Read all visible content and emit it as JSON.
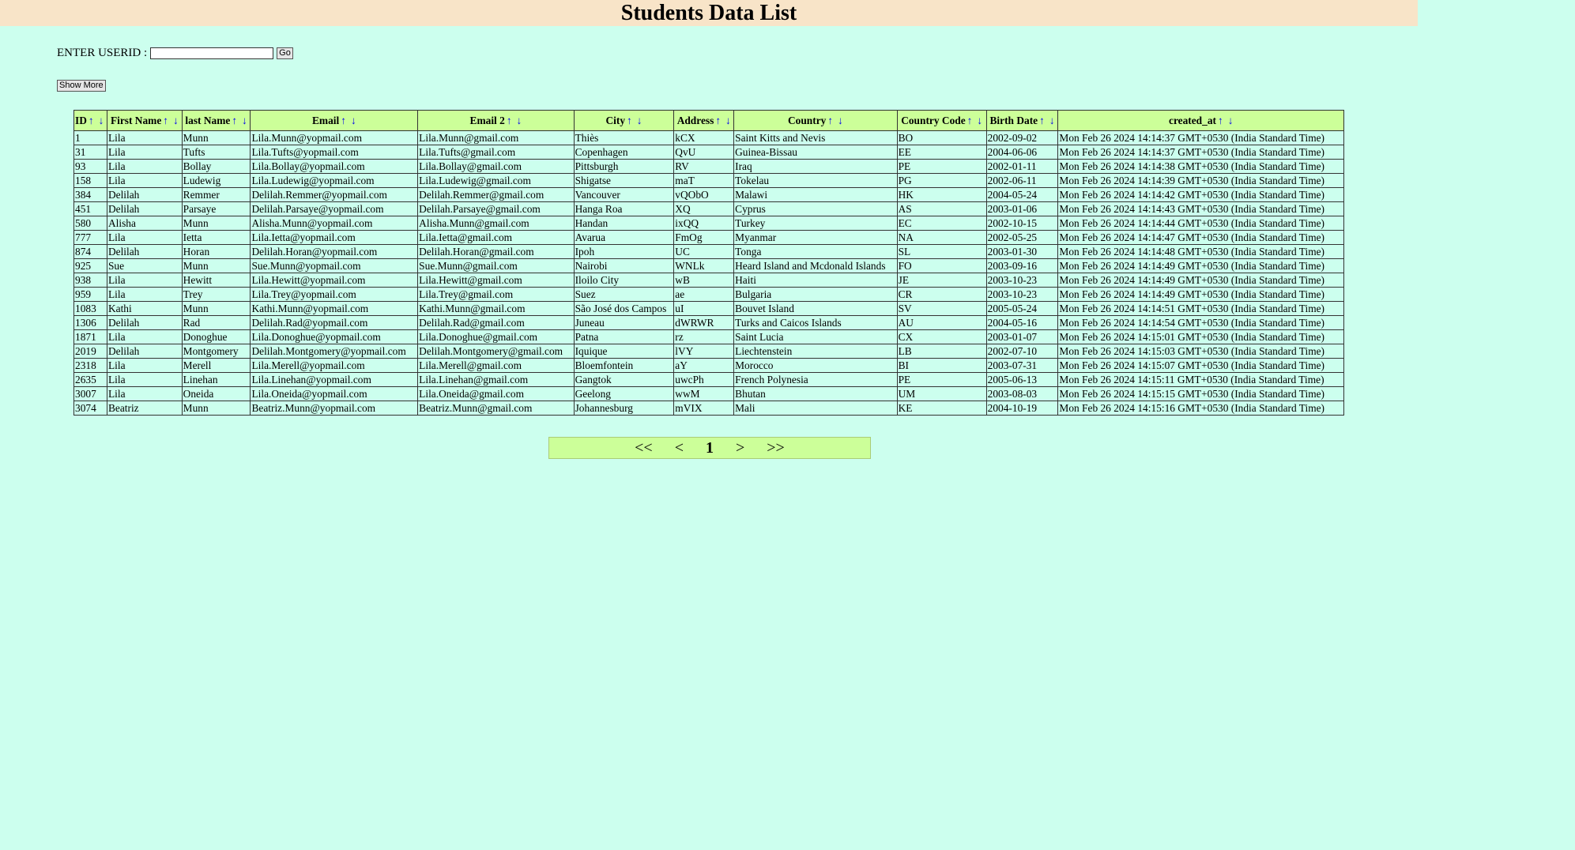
{
  "page": {
    "title": "Students Data List"
  },
  "search": {
    "label": "ENTER USERID :",
    "value": "",
    "placeholder": "",
    "go_label": "Go"
  },
  "show_more_label": "Show More",
  "sort": {
    "up": "↑",
    "down": "↓"
  },
  "table": {
    "columns": [
      "ID",
      "First Name",
      "last Name",
      "Email",
      "Email 2",
      "City",
      "Address",
      "Country",
      "Country Code",
      "Birth Date",
      "created_at"
    ],
    "rows": [
      [
        "1",
        "Lila",
        "Munn",
        "Lila.Munn@yopmail.com",
        "Lila.Munn@gmail.com",
        "Thiès",
        "kCX",
        "Saint Kitts and Nevis",
        "BO",
        "2002-09-02",
        "Mon Feb 26 2024 14:14:37 GMT+0530 (India Standard Time)"
      ],
      [
        "31",
        "Lila",
        "Tufts",
        "Lila.Tufts@yopmail.com",
        "Lila.Tufts@gmail.com",
        "Copenhagen",
        "QvU",
        "Guinea-Bissau",
        "EE",
        "2004-06-06",
        "Mon Feb 26 2024 14:14:37 GMT+0530 (India Standard Time)"
      ],
      [
        "93",
        "Lila",
        "Bollay",
        "Lila.Bollay@yopmail.com",
        "Lila.Bollay@gmail.com",
        "Pittsburgh",
        "RV",
        "Iraq",
        "PE",
        "2002-01-11",
        "Mon Feb 26 2024 14:14:38 GMT+0530 (India Standard Time)"
      ],
      [
        "158",
        "Lila",
        "Ludewig",
        "Lila.Ludewig@yopmail.com",
        "Lila.Ludewig@gmail.com",
        "Shigatse",
        "maT",
        "Tokelau",
        "PG",
        "2002-06-11",
        "Mon Feb 26 2024 14:14:39 GMT+0530 (India Standard Time)"
      ],
      [
        "384",
        "Delilah",
        "Remmer",
        "Delilah.Remmer@yopmail.com",
        "Delilah.Remmer@gmail.com",
        "Vancouver",
        "vQObO",
        "Malawi",
        "HK",
        "2004-05-24",
        "Mon Feb 26 2024 14:14:42 GMT+0530 (India Standard Time)"
      ],
      [
        "451",
        "Delilah",
        "Parsaye",
        "Delilah.Parsaye@yopmail.com",
        "Delilah.Parsaye@gmail.com",
        "Hanga Roa",
        "XQ",
        "Cyprus",
        "AS",
        "2003-01-06",
        "Mon Feb 26 2024 14:14:43 GMT+0530 (India Standard Time)"
      ],
      [
        "580",
        "Alisha",
        "Munn",
        "Alisha.Munn@yopmail.com",
        "Alisha.Munn@gmail.com",
        "Handan",
        "ixQQ",
        "Turkey",
        "EC",
        "2002-10-15",
        "Mon Feb 26 2024 14:14:44 GMT+0530 (India Standard Time)"
      ],
      [
        "777",
        "Lila",
        "Ietta",
        "Lila.Ietta@yopmail.com",
        "Lila.Ietta@gmail.com",
        "Avarua",
        "FmOg",
        "Myanmar",
        "NA",
        "2002-05-25",
        "Mon Feb 26 2024 14:14:47 GMT+0530 (India Standard Time)"
      ],
      [
        "874",
        "Delilah",
        "Horan",
        "Delilah.Horan@yopmail.com",
        "Delilah.Horan@gmail.com",
        "Ipoh",
        "UC",
        "Tonga",
        "SL",
        "2003-01-30",
        "Mon Feb 26 2024 14:14:48 GMT+0530 (India Standard Time)"
      ],
      [
        "925",
        "Sue",
        "Munn",
        "Sue.Munn@yopmail.com",
        "Sue.Munn@gmail.com",
        "Nairobi",
        "WNLk",
        "Heard Island and Mcdonald Islands",
        "FO",
        "2003-09-16",
        "Mon Feb 26 2024 14:14:49 GMT+0530 (India Standard Time)"
      ],
      [
        "938",
        "Lila",
        "Hewitt",
        "Lila.Hewitt@yopmail.com",
        "Lila.Hewitt@gmail.com",
        "Iloilo City",
        "wB",
        "Haiti",
        "JE",
        "2003-10-23",
        "Mon Feb 26 2024 14:14:49 GMT+0530 (India Standard Time)"
      ],
      [
        "959",
        "Lila",
        "Trey",
        "Lila.Trey@yopmail.com",
        "Lila.Trey@gmail.com",
        "Suez",
        "ae",
        "Bulgaria",
        "CR",
        "2003-10-23",
        "Mon Feb 26 2024 14:14:49 GMT+0530 (India Standard Time)"
      ],
      [
        "1083",
        "Kathi",
        "Munn",
        "Kathi.Munn@yopmail.com",
        "Kathi.Munn@gmail.com",
        "São José dos Campos",
        "uI",
        "Bouvet Island",
        "SV",
        "2005-05-24",
        "Mon Feb 26 2024 14:14:51 GMT+0530 (India Standard Time)"
      ],
      [
        "1306",
        "Delilah",
        "Rad",
        "Delilah.Rad@yopmail.com",
        "Delilah.Rad@gmail.com",
        "Juneau",
        "dWRWR",
        "Turks and Caicos Islands",
        "AU",
        "2004-05-16",
        "Mon Feb 26 2024 14:14:54 GMT+0530 (India Standard Time)"
      ],
      [
        "1871",
        "Lila",
        "Donoghue",
        "Lila.Donoghue@yopmail.com",
        "Lila.Donoghue@gmail.com",
        "Patna",
        "rz",
        "Saint Lucia",
        "CX",
        "2003-01-07",
        "Mon Feb 26 2024 14:15:01 GMT+0530 (India Standard Time)"
      ],
      [
        "2019",
        "Delilah",
        "Montgomery",
        "Delilah.Montgomery@yopmail.com",
        "Delilah.Montgomery@gmail.com",
        "Iquique",
        "lVY",
        "Liechtenstein",
        "LB",
        "2002-07-10",
        "Mon Feb 26 2024 14:15:03 GMT+0530 (India Standard Time)"
      ],
      [
        "2318",
        "Lila",
        "Merell",
        "Lila.Merell@yopmail.com",
        "Lila.Merell@gmail.com",
        "Bloemfontein",
        "aY",
        "Morocco",
        "BI",
        "2003-07-31",
        "Mon Feb 26 2024 14:15:07 GMT+0530 (India Standard Time)"
      ],
      [
        "2635",
        "Lila",
        "Linehan",
        "Lila.Linehan@yopmail.com",
        "Lila.Linehan@gmail.com",
        "Gangtok",
        "uwcPh",
        "French Polynesia",
        "PE",
        "2005-06-13",
        "Mon Feb 26 2024 14:15:11 GMT+0530 (India Standard Time)"
      ],
      [
        "3007",
        "Lila",
        "Oneida",
        "Lila.Oneida@yopmail.com",
        "Lila.Oneida@gmail.com",
        "Geelong",
        "wwM",
        "Bhutan",
        "UM",
        "2003-08-03",
        "Mon Feb 26 2024 14:15:15 GMT+0530 (India Standard Time)"
      ],
      [
        "3074",
        "Beatriz",
        "Munn",
        "Beatriz.Munn@yopmail.com",
        "Beatriz.Munn@gmail.com",
        "Johannesburg",
        "mVIX",
        "Mali",
        "KE",
        "2004-10-19",
        "Mon Feb 26 2024 14:15:16 GMT+0530 (India Standard Time)"
      ]
    ]
  },
  "pagination": {
    "first": "<<",
    "prev": "<",
    "current": "1",
    "next": ">",
    "last": ">>"
  }
}
